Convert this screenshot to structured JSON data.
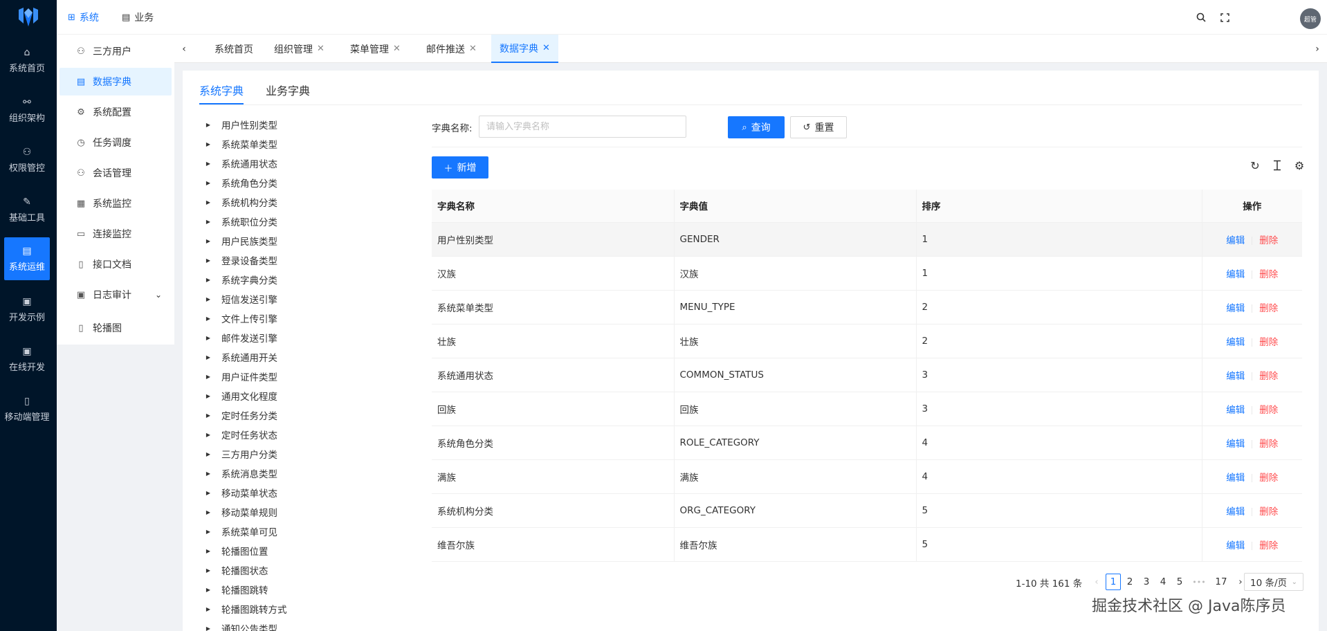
{
  "rail": {
    "items": [
      {
        "label": "系统首页",
        "icon": "⌂"
      },
      {
        "label": "组织架构",
        "icon": "⚯"
      },
      {
        "label": "权限管控",
        "icon": "⚇"
      },
      {
        "label": "基础工具",
        "icon": "✎"
      },
      {
        "label": "系统运维",
        "icon": "▤"
      },
      {
        "label": "开发示例",
        "icon": "▣"
      },
      {
        "label": "在线开发",
        "icon": "▣"
      },
      {
        "label": "移动端管理",
        "icon": "▯"
      }
    ]
  },
  "topnav": {
    "system": "系统",
    "business": "业务",
    "avatar_text": "超管"
  },
  "submenu": {
    "items": [
      {
        "label": "三方用户",
        "icon": "⚇"
      },
      {
        "label": "数据字典",
        "icon": "▤"
      },
      {
        "label": "系统配置",
        "icon": "⚙"
      },
      {
        "label": "任务调度",
        "icon": "◷"
      },
      {
        "label": "会话管理",
        "icon": "⚇"
      },
      {
        "label": "系统监控",
        "icon": "▦"
      },
      {
        "label": "连接监控",
        "icon": "▭"
      },
      {
        "label": "接口文档",
        "icon": "▯"
      },
      {
        "label": "日志审计",
        "icon": "▣"
      },
      {
        "label": "轮播图",
        "icon": "▯"
      }
    ]
  },
  "tabs": [
    {
      "label": "系统首页"
    },
    {
      "label": "组织管理"
    },
    {
      "label": "菜单管理"
    },
    {
      "label": "邮件推送"
    },
    {
      "label": "数据字典"
    }
  ],
  "dict_tabs": {
    "system": "系统字典",
    "business": "业务字典"
  },
  "tree": [
    "用户性别类型",
    "系统菜单类型",
    "系统通用状态",
    "系统角色分类",
    "系统机构分类",
    "系统职位分类",
    "用户民族类型",
    "登录设备类型",
    "系统字典分类",
    "短信发送引擎",
    "文件上传引擎",
    "邮件发送引擎",
    "系统通用开关",
    "用户证件类型",
    "通用文化程度",
    "定时任务分类",
    "定时任务状态",
    "三方用户分类",
    "系统消息类型",
    "移动菜单状态",
    "移动菜单规则",
    "系统菜单可见",
    "轮播图位置",
    "轮播图状态",
    "轮播图跳转",
    "轮播图跳转方式",
    "通知公告类型"
  ],
  "search": {
    "label": "字典名称:",
    "placeholder": "请输入字典名称",
    "query_label": "查询",
    "reset_label": "重置",
    "add_label": "新增"
  },
  "table": {
    "headers": [
      "字典名称",
      "字典值",
      "排序",
      "操作"
    ],
    "edit_label": "编辑",
    "delete_label": "删除",
    "rows": [
      {
        "name": "用户性别类型",
        "value": "GENDER",
        "sort": "1"
      },
      {
        "name": "汉族",
        "value": "汉族",
        "sort": "1"
      },
      {
        "name": "系统菜单类型",
        "value": "MENU_TYPE",
        "sort": "2"
      },
      {
        "name": "壮族",
        "value": "壮族",
        "sort": "2"
      },
      {
        "name": "系统通用状态",
        "value": "COMMON_STATUS",
        "sort": "3"
      },
      {
        "name": "回族",
        "value": "回族",
        "sort": "3"
      },
      {
        "name": "系统角色分类",
        "value": "ROLE_CATEGORY",
        "sort": "4"
      },
      {
        "name": "满族",
        "value": "满族",
        "sort": "4"
      },
      {
        "name": "系统机构分类",
        "value": "ORG_CATEGORY",
        "sort": "5"
      },
      {
        "name": "维吾尔族",
        "value": "维吾尔族",
        "sort": "5"
      }
    ]
  },
  "pagination": {
    "total_text": "1-10 共 161 条",
    "pages": [
      "1",
      "2",
      "3",
      "4",
      "5"
    ],
    "ellipsis": "•••",
    "last_page": "17",
    "current": 1,
    "page_size": "10 条/页"
  },
  "watermark": "掘金技术社区 @ Java陈序员",
  "colors": {
    "primary": "#1677ff",
    "danger": "#ff4d4f",
    "rail_bg": "#001529"
  }
}
